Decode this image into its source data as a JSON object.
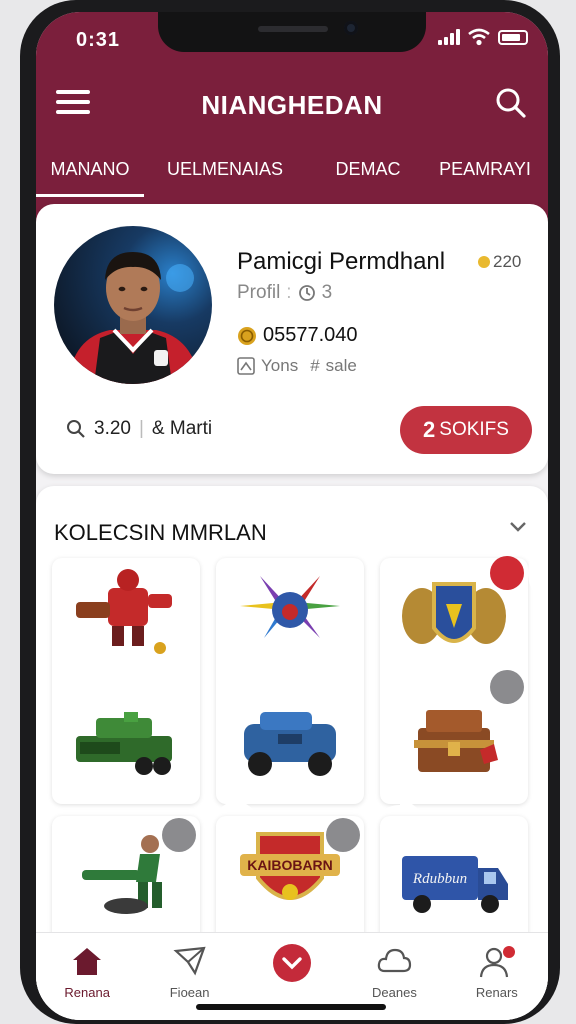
{
  "status": {
    "time": "0:31"
  },
  "header": {
    "title": "NIANGHEDAN"
  },
  "tabs": [
    {
      "label": "MANANO"
    },
    {
      "label": "UELMENAIAS"
    },
    {
      "label": "DEMAC"
    },
    {
      "label": "PEAMRAYI"
    }
  ],
  "profile": {
    "name": "Pamicgi Permdhanl",
    "badge_count": "220",
    "sub_label": "Profil",
    "sub_count": "3",
    "coins": "05577.040",
    "tag1": "Yons",
    "tag2": "sale",
    "stat1": "3.20",
    "stat2": "& Marti",
    "action_number": "2",
    "action_label": "SOKIFS"
  },
  "collection": {
    "title": "KOLECSIN MMRLAN",
    "items": [
      {
        "icon": "robot-figure-icon",
        "badge": null
      },
      {
        "icon": "spiked-drone-icon",
        "badge": null
      },
      {
        "icon": "armored-shield-icon",
        "badge": "target-icon"
      },
      {
        "icon": "green-tank-icon",
        "badge": null
      },
      {
        "icon": "blue-vehicle-icon",
        "badge": null
      },
      {
        "icon": "treasure-chest-icon",
        "badge": "close-icon"
      },
      {
        "icon": "flying-hero-icon",
        "badge": "lock-icon"
      },
      {
        "icon": "emblem-icon",
        "badge": "rotate-icon",
        "emblem_text": "KAIBOBARN"
      },
      {
        "icon": "delivery-truck-icon",
        "badge": null,
        "truck_text": "Rdubbun"
      }
    ]
  },
  "nav": [
    {
      "label": "Renana",
      "icon": "home-icon"
    },
    {
      "label": "Fioean",
      "icon": "send-icon"
    },
    {
      "label": "",
      "icon": "center-action-icon"
    },
    {
      "label": "Deanes",
      "icon": "cloud-icon"
    },
    {
      "label": "Renars",
      "icon": "profile-icon"
    }
  ],
  "colors": {
    "brand": "#7b1f3c",
    "accent": "#c23340",
    "coin": "#e9b92f"
  }
}
